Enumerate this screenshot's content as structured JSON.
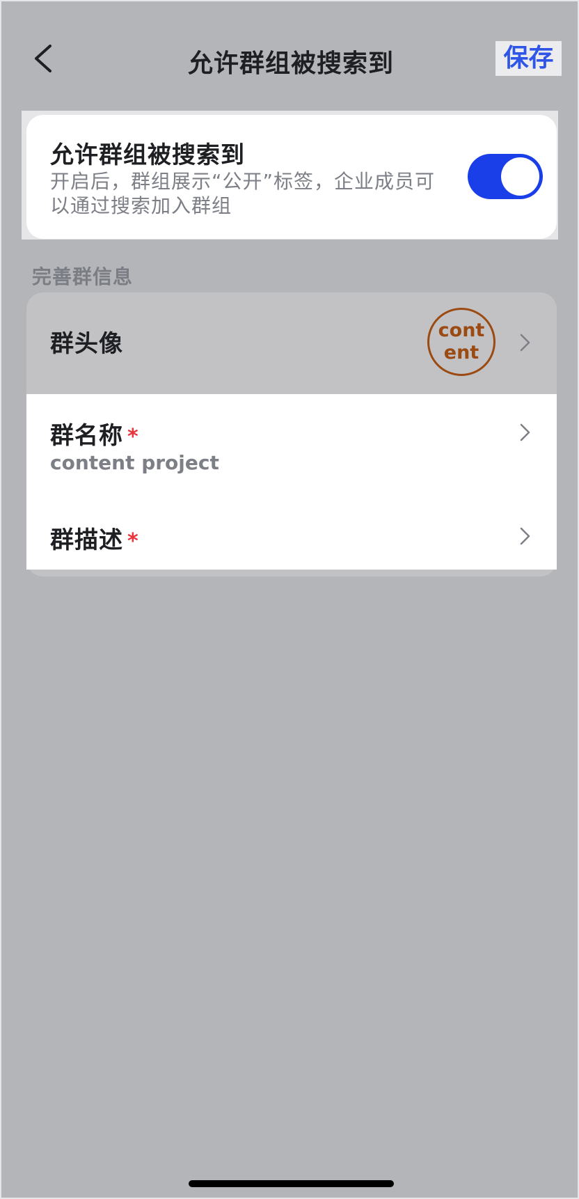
{
  "nav": {
    "title": "允许群组被搜索到",
    "save_label": "保存",
    "back_icon": "chevron-left-icon"
  },
  "search_toggle": {
    "title": "允许群组被搜索到",
    "description": "开启后，群组展示“公开”标签，企业成员可以通过搜索加入群组",
    "enabled": true,
    "accent_color": "#1a3fe8"
  },
  "section": {
    "label": "完善群信息"
  },
  "rows": {
    "avatar": {
      "label": "群头像",
      "avatar_text": "content",
      "avatar_color": "#9b4a12"
    },
    "name": {
      "label": "群名称",
      "required_mark": "*",
      "value": "content project"
    },
    "description": {
      "label": "群描述",
      "required_mark": "*"
    }
  },
  "colors": {
    "background": "#b4b5b8",
    "save_text": "#2f55e8",
    "required": "#e8333a"
  }
}
